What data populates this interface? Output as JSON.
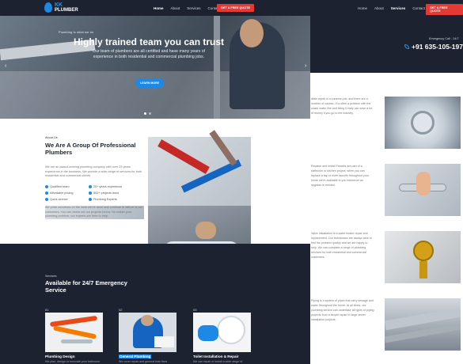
{
  "brand": {
    "top": "KK",
    "bottom": "PLUMBER"
  },
  "nav_left": {
    "items": [
      "Home",
      "About",
      "Services",
      "Contact"
    ],
    "active": "Home",
    "quote": "GET A FREE QUOTE"
  },
  "hero": {
    "kicker": "Plumbing is what we do",
    "title": "Highly trained team you can trust",
    "subtitle": "Our team of plumbers are all certified and have many years of experience in both residential and commercial plumbing jobs.",
    "button": "LEARN MORE",
    "prev": "‹",
    "next": "›"
  },
  "about": {
    "kicker": "About Us",
    "title": "We Are A Group Of Professional Plumbers",
    "para": "We are an award-winning plumbing company with over 25 years experience in the business. We provide a wide range of services for both residential and commercial clients.",
    "checks": [
      "Qualified team",
      "25+ years experience",
      "Affordable pricing",
      "500+ projects done",
      "Quick service",
      "Plumbing Experts"
    ],
    "para2": "We pride ourselves on the work we've done and continue to deliver to our customers. You can check out our projects below. No matter your plumbing problem, our experts are here to help."
  },
  "services": {
    "kicker": "Services",
    "title": "Available for 24/7 Emergency Service",
    "cards": [
      {
        "num": "01",
        "title": "Plumbing Design",
        "desc": "We plan, design or renovate your bathroom"
      },
      {
        "num": "02",
        "title": "General Plumbing",
        "desc": "We cover repair and general leak fixes"
      },
      {
        "num": "03",
        "title": "Toilet Installation & Repair",
        "desc": "We can repair or install a wide range of"
      }
    ]
  },
  "nav_right": {
    "items": [
      "Home",
      "About",
      "Services",
      "Contact"
    ],
    "active": "Services",
    "quote": "GET A FREE QUOTE"
  },
  "emergency": {
    "kicker": "Emergency Call - 24/7",
    "phone": "+91 635-105-1970"
  },
  "right_rows": [
    "drain repair is a common job, and there are a number of causes. It is often a problem with the waste water line and fixing it early can save a lot of money if you go to the industry.",
    "Replace and Install Faucets are part of a bathroom or kitchen project, when you can replace a tap or more faucets throughout your home we're available to you whenever an upgrade is needed.",
    "Valve Installation is a water heater repair and replacement. Our technicians are always able to find the problem quickly and we are happy to help. We can complete a range of plumbing services for both residential and commercial customers.",
    "Piping is a system of pipes that carry sewage and water throughout the home. At all times, our plumbing service can undertake all types of piping projects from a simple repair to large sewer installation projects."
  ]
}
